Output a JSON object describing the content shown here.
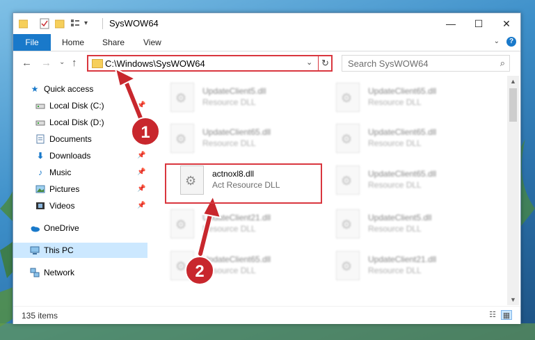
{
  "window": {
    "title": "SysWOW64",
    "controls": {
      "minimize": "—",
      "maximize": "☐",
      "close": "✕"
    }
  },
  "ribbon": {
    "tabs": [
      "File",
      "Home",
      "Share",
      "View"
    ],
    "toggle": "⌄",
    "help": "?"
  },
  "address": {
    "path": "C:\\Windows\\SysWOW64",
    "dropdown": "⌄",
    "refresh": "↻"
  },
  "search": {
    "placeholder": "Search SysWOW64",
    "icon": "search-icon"
  },
  "nav": {
    "back": "←",
    "forward": "→",
    "recent": "⌄",
    "up": "↑",
    "items": [
      {
        "label": "Quick access",
        "icon": "star-icon",
        "pinned": false
      },
      {
        "label": "Local Disk (C:)",
        "icon": "drive-icon",
        "pinned": true
      },
      {
        "label": "Local Disk (D:)",
        "icon": "drive-icon",
        "pinned": true
      },
      {
        "label": "Documents",
        "icon": "documents-icon",
        "pinned": true
      },
      {
        "label": "Downloads",
        "icon": "downloads-icon",
        "pinned": true
      },
      {
        "label": "Music",
        "icon": "music-icon",
        "pinned": true
      },
      {
        "label": "Pictures",
        "icon": "pictures-icon",
        "pinned": true
      },
      {
        "label": "Videos",
        "icon": "videos-icon",
        "pinned": true
      },
      {
        "label": "OneDrive",
        "icon": "onedrive-icon",
        "pinned": false
      },
      {
        "label": "This PC",
        "icon": "pc-icon",
        "pinned": false,
        "selected": true
      },
      {
        "label": "Network",
        "icon": "network-icon",
        "pinned": false
      }
    ]
  },
  "files": [
    {
      "name": "UpdateClient5.dll",
      "type": "Resource DLL"
    },
    {
      "name": "UpdateClient65.dll",
      "type": "Resource DLL"
    },
    {
      "name": "UpdateClient65.dll",
      "type": "Resource DLL"
    },
    {
      "name": "UpdateClient65.dll",
      "type": "Resource DLL"
    },
    {
      "name": "actnoxl8.dll",
      "type": "Act Resource DLL",
      "highlighted": true
    },
    {
      "name": "UpdateClient65.dll",
      "type": "Resource DLL"
    },
    {
      "name": "UpdateClient21.dll",
      "type": "Resource DLL"
    },
    {
      "name": "UpdateClient5.dll",
      "type": "Resource DLL"
    },
    {
      "name": "UpdateClient65.dll",
      "type": "Resource DLL"
    },
    {
      "name": "UpdateClient21.dll",
      "type": "Resource DLL"
    }
  ],
  "status": {
    "item_count": "135 items"
  },
  "annotations": {
    "step1": "1",
    "step2": "2"
  },
  "colors": {
    "accent": "#1979ca",
    "highlight": "#d9363e",
    "selected": "#cce8ff"
  }
}
